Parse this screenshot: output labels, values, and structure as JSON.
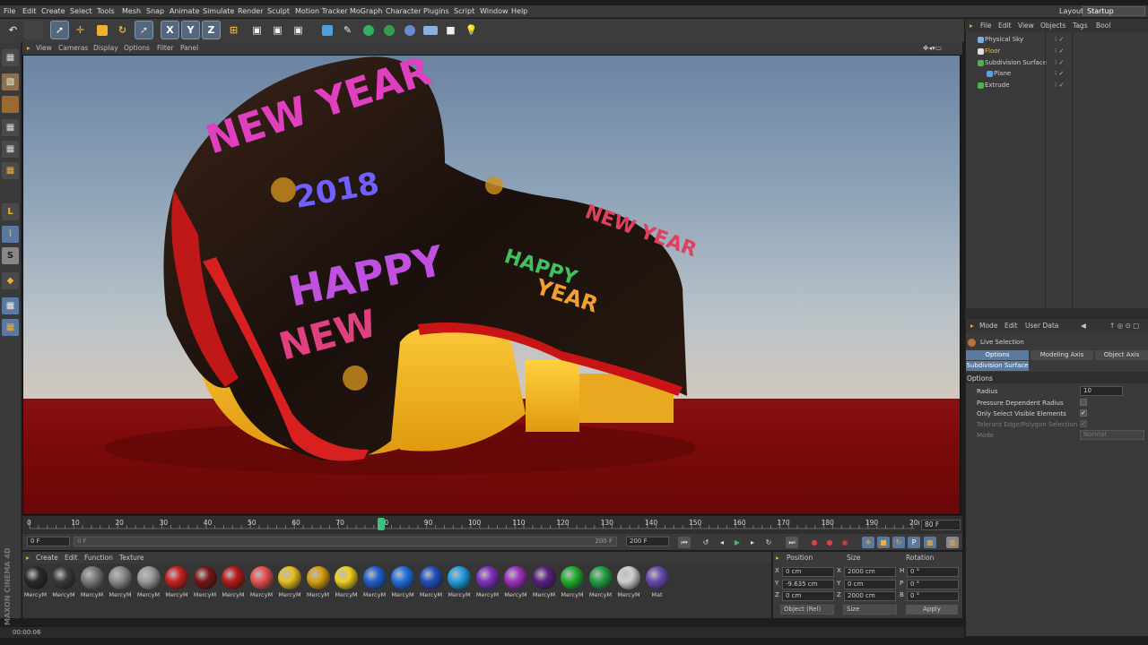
{
  "menubar": {
    "items": [
      "File",
      "Edit",
      "Create",
      "Select",
      "Tools",
      "Mesh",
      "Snap",
      "Animate",
      "Simulate",
      "Render",
      "Sculpt",
      "Motion Tracker",
      "MoGraph",
      "Character",
      "Plugins",
      "Script",
      "Window",
      "Help"
    ],
    "layout_label": "Layout:",
    "layout_value": "Startup"
  },
  "viewport": {
    "menu": [
      "View",
      "Cameras",
      "Display",
      "Options",
      "Filter",
      "Panel"
    ],
    "scene_text": [
      "NEW YEAR",
      "2018",
      "HAPPY",
      "NEW",
      "NEW YEAR",
      "HAPPY",
      "YEAR"
    ]
  },
  "timeline": {
    "ticks": [
      "0",
      "10",
      "20",
      "30",
      "40",
      "50",
      "60",
      "70",
      "80",
      "90",
      "100",
      "110",
      "120",
      "130",
      "140",
      "150",
      "160",
      "170",
      "180",
      "190",
      "20("
    ],
    "current_frame": "80 F",
    "start_field": "0 F",
    "range_start": "0 F",
    "range_end": "200 F",
    "end_field": "200 F"
  },
  "materials": {
    "menu": [
      "Create",
      "Edit",
      "Function",
      "Texture"
    ],
    "items": [
      {
        "label": "MercyM",
        "color": "#2a2a2a"
      },
      {
        "label": "MercyM",
        "color": "#3a3a3a"
      },
      {
        "label": "MercyM",
        "color": "#7a7a7a"
      },
      {
        "label": "MercyM",
        "color": "#8a8a8a"
      },
      {
        "label": "MercyM",
        "color": "#9a9a9a"
      },
      {
        "label": "MercyM",
        "color": "#cc2020"
      },
      {
        "label": "MercyM",
        "color": "#7a1414"
      },
      {
        "label": "MercyM",
        "color": "#b81818"
      },
      {
        "label": "MercyM",
        "color": "#e85050"
      },
      {
        "label": "MercyM",
        "color": "#e8c020"
      },
      {
        "label": "MercyM",
        "color": "#d8a010"
      },
      {
        "label": "MercyM",
        "color": "#f0d020"
      },
      {
        "label": "MercyM",
        "color": "#2060d0"
      },
      {
        "label": "MercyM",
        "color": "#2070e0"
      },
      {
        "label": "MercyM",
        "color": "#2050c0"
      },
      {
        "label": "MercyM",
        "color": "#20a0e0"
      },
      {
        "label": "MercyM",
        "color": "#8030c0"
      },
      {
        "label": "MercyM",
        "color": "#a030c0"
      },
      {
        "label": "MercyM",
        "color": "#5a2080"
      },
      {
        "label": "MercyM",
        "color": "#20b030"
      },
      {
        "label": "MercyM",
        "color": "#20a040"
      },
      {
        "label": "MercyM",
        "color": "#d0d0d0"
      },
      {
        "label": "Mat",
        "color": "#6a4ab0"
      }
    ]
  },
  "coordinates": {
    "headers": [
      "Position",
      "Size",
      "Rotation"
    ],
    "rows": [
      {
        "axis": "X",
        "pos": "0 cm",
        "saxis": "X",
        "size": "2000 cm",
        "raxis": "H",
        "rot": "0 °"
      },
      {
        "axis": "Y",
        "pos": "-9.635 cm",
        "saxis": "Y",
        "size": "0 cm",
        "raxis": "P",
        "rot": "0 °"
      },
      {
        "axis": "Z",
        "pos": "0 cm",
        "saxis": "Z",
        "size": "2000 cm",
        "raxis": "B",
        "rot": "0 °"
      }
    ],
    "mode": "Object (Rel)",
    "size_mode": "Size",
    "apply": "Apply"
  },
  "status": {
    "time": "00:00:06"
  },
  "object_manager": {
    "menu": [
      "File",
      "Edit",
      "View",
      "Objects",
      "Tags",
      "Bool"
    ],
    "objects": [
      {
        "name": "Physical Sky",
        "color": "#d0d0d0",
        "icon": "#7ab0e0"
      },
      {
        "name": "Floor",
        "color": "#f0c040",
        "icon": "#e0e0e0"
      },
      {
        "name": "Subdivision Surface",
        "color": "#d0d0d0",
        "icon": "#50b050"
      },
      {
        "name": "Plane",
        "color": "#d0d0d0",
        "icon": "#60a0e0"
      },
      {
        "name": "Extrude",
        "color": "#d0d0d0",
        "icon": "#50b050"
      }
    ]
  },
  "attribute_manager": {
    "menu": [
      "Mode",
      "Edit",
      "User Data"
    ],
    "tool": "Live Selection",
    "tabs": [
      "Options",
      "Modeling Axis",
      "Object Axis"
    ],
    "subtab": "Subdivision Surface",
    "section": "Options",
    "radius_label": "Radius",
    "radius_value": "10",
    "pressure_label": "Pressure Dependent Radius",
    "visible_label": "Only Select Visible Elements",
    "tolerant_label": "Tolerant Edge/Polygon Selection",
    "mode_label": "Mode",
    "mode_value": "Normal"
  },
  "logo": "MAXON CINEMA 4D"
}
